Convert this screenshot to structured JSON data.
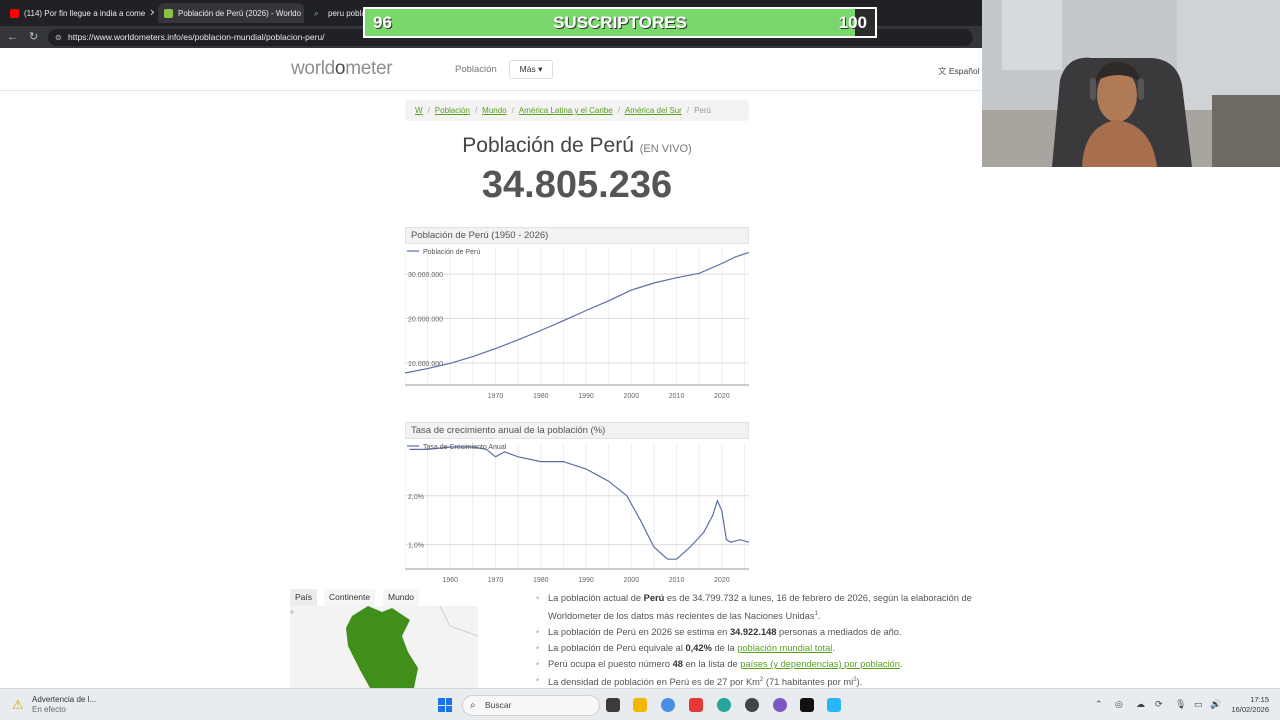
{
  "browser": {
    "tabs": [
      {
        "title": "(114) Por fin llegue a india a come",
        "favicon": "youtube-icon",
        "active": false
      },
      {
        "title": "Población de Perú (2026) - Worldo",
        "favicon": "worldometer-icon",
        "active": true
      },
      {
        "title": "peru poblac",
        "favicon": "search-icon",
        "active": false
      }
    ],
    "url": "https://www.worldometers.info/es/poblacion-mundial/poblacion-peru/"
  },
  "overlay": {
    "current": "96",
    "label": "SUSCRIPTORES",
    "goal": "100",
    "progress": 0.96,
    "fill_color": "#79d86b"
  },
  "site": {
    "logo": {
      "pre": "world",
      "o": "o",
      "post": "meter"
    },
    "nav": {
      "poblacion": "Población",
      "mas": "Más ▾"
    },
    "language": "Español"
  },
  "breadcrumb": {
    "items": [
      "W",
      "Población",
      "Mundo",
      "América Latina y el Caribe",
      "América del Sur"
    ],
    "current": "Perú"
  },
  "heading": {
    "title": "Población de Perú",
    "live": "(EN VIVO)",
    "count": "34.805.236"
  },
  "charts": {
    "population": {
      "title": "Población de Perú (1950 - 2026)",
      "legend": "Población de Perú",
      "y_ticks": [
        "10.000.000",
        "20.000.000",
        "30.000.000"
      ],
      "x_ticks": [
        "1970",
        "1980",
        "1990",
        "2000",
        "2010",
        "2020"
      ]
    },
    "growth": {
      "title": "Tasa de crecimiento anual de la población (%)",
      "legend": "Tasa de Crecimiento Anual",
      "y_ticks": [
        "1,0%",
        "2,0%"
      ],
      "x_ticks": [
        "1960",
        "1970",
        "1980",
        "1990",
        "2000",
        "2010",
        "2020"
      ]
    }
  },
  "chart_data": [
    {
      "type": "line",
      "title": "Población de Perú (1950 - 2026)",
      "series": [
        {
          "name": "Población de Perú"
        }
      ],
      "x": [
        1950,
        1955,
        1960,
        1965,
        1970,
        1975,
        1980,
        1985,
        1990,
        1995,
        2000,
        2005,
        2010,
        2015,
        2020,
        2023,
        2026
      ],
      "values": [
        7700000,
        8700000,
        9900000,
        11400000,
        13200000,
        15200000,
        17300000,
        19500000,
        21800000,
        24000000,
        26400000,
        28000000,
        29200000,
        30200000,
        32400000,
        33900000,
        34900000
      ],
      "xlim": [
        1950,
        2026
      ],
      "ylim": [
        5000000,
        35000000
      ],
      "grid": true
    },
    {
      "type": "line",
      "title": "Tasa de crecimiento anual de la población (%)",
      "series": [
        {
          "name": "Tasa de Crecimiento Anual"
        }
      ],
      "x": [
        1951,
        1955,
        1960,
        1965,
        1968,
        1970,
        1972,
        1975,
        1980,
        1985,
        1990,
        1993,
        1995,
        1999,
        2002,
        2005,
        2008,
        2010,
        2013,
        2016,
        2018,
        2019,
        2020,
        2021,
        2022,
        2024,
        2026
      ],
      "values": [
        2.95,
        2.95,
        3.0,
        3.0,
        2.95,
        2.8,
        2.9,
        2.8,
        2.7,
        2.7,
        2.55,
        2.4,
        2.3,
        2.0,
        1.5,
        0.95,
        0.7,
        0.7,
        0.95,
        1.25,
        1.6,
        1.9,
        1.7,
        1.1,
        1.05,
        1.1,
        1.05
      ],
      "xlim": [
        1950,
        2026
      ],
      "ylim": [
        0.5,
        3.0
      ],
      "grid": true
    }
  ],
  "map_tabs": [
    "País",
    "Continente",
    "Mundo"
  ],
  "facts": [
    {
      "parts": [
        {
          "t": "text",
          "v": "La población actual de "
        },
        {
          "t": "bold",
          "v": "Perú"
        },
        {
          "t": "text",
          "v": " es de 34.799.732 a lunes, 16 de febrero de 2026, según la elaboración de Worldometer de los datos más recientes de las Naciones Unidas"
        },
        {
          "t": "sup",
          "v": "1"
        },
        {
          "t": "text",
          "v": "."
        }
      ]
    },
    {
      "parts": [
        {
          "t": "text",
          "v": "La población de Perú en 2026 se estima en "
        },
        {
          "t": "bold",
          "v": "34.922.148"
        },
        {
          "t": "text",
          "v": " personas a mediados de año."
        }
      ]
    },
    {
      "parts": [
        {
          "t": "text",
          "v": "La población de Perú equivale al "
        },
        {
          "t": "bold",
          "v": "0,42%"
        },
        {
          "t": "text",
          "v": " de la "
        },
        {
          "t": "link",
          "v": "población mundial total"
        },
        {
          "t": "text",
          "v": "."
        }
      ]
    },
    {
      "parts": [
        {
          "t": "text",
          "v": "Perú ocupa el puesto número "
        },
        {
          "t": "bold",
          "v": "48"
        },
        {
          "t": "text",
          "v": " en la lista de "
        },
        {
          "t": "link",
          "v": "países (y dependencias) por población"
        },
        {
          "t": "text",
          "v": "."
        }
      ]
    },
    {
      "parts": [
        {
          "t": "text",
          "v": "La densidad de población en Perú es de 27 por Km"
        },
        {
          "t": "sup",
          "v": "2"
        },
        {
          "t": "text",
          "v": " (71 habitantes por mi"
        },
        {
          "t": "sup",
          "v": "2"
        },
        {
          "t": "text",
          "v": ")."
        }
      ]
    }
  ],
  "taskbar": {
    "warning_title": "Advertencia de l...",
    "warning_sub": "En efecto",
    "search": "Buscar",
    "time": "17:15",
    "date": "16/02/2026"
  },
  "colors": {
    "accent_link": "#58a020",
    "chart_line": "#5b6fa6",
    "map_country": "#3f8f1a"
  }
}
